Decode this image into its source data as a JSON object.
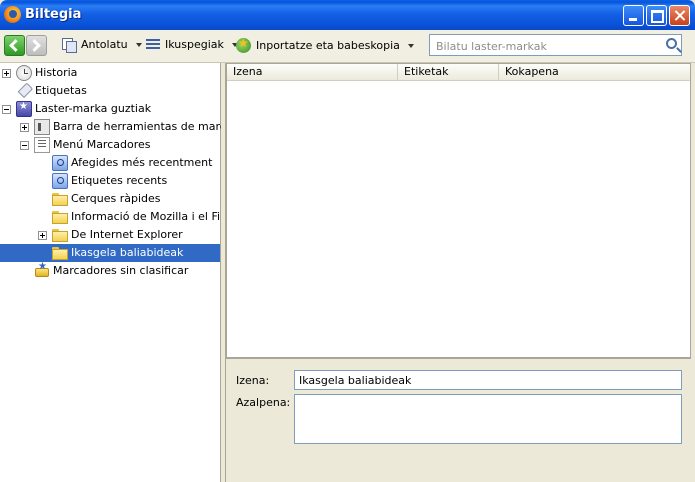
{
  "window": {
    "title": "Biltegia"
  },
  "toolbar": {
    "organize_label": "Antolatu",
    "views_label": "Ikuspegiak",
    "import_label": "Inportatze eta babeskopia",
    "search_placeholder": "Bilatu laster-markak"
  },
  "tree": {
    "items": [
      {
        "label": "Historia",
        "icon": "history-clock-icon",
        "twisty": "plus"
      },
      {
        "label": "Etiquetas",
        "icon": "tag-icon",
        "twisty": "none"
      },
      {
        "label": "Laster-marka guztiak",
        "icon": "all-bookmarks-icon",
        "twisty": "minus"
      },
      {
        "label": "Barra de herramientas de marca...",
        "icon": "bookmarks-toolbar-icon",
        "twisty": "plus"
      },
      {
        "label": "Menú Marcadores",
        "icon": "bookmarks-menu-icon",
        "twisty": "minus"
      },
      {
        "label": "Afegides més recentment",
        "icon": "smart-query-icon",
        "twisty": "none"
      },
      {
        "label": "Etiquetes recents",
        "icon": "smart-query-icon",
        "twisty": "none"
      },
      {
        "label": "Cerques ràpides",
        "icon": "folder-icon",
        "twisty": "none"
      },
      {
        "label": "Informació de Mozilla i el Fire...",
        "icon": "folder-icon",
        "twisty": "none"
      },
      {
        "label": "De Internet Explorer",
        "icon": "folder-icon",
        "twisty": "plus"
      },
      {
        "label": "Ikasgela baliabideak",
        "icon": "folder-icon",
        "twisty": "none",
        "selected": true
      },
      {
        "label": "Marcadores sin clasificar",
        "icon": "unsorted-bookmarks-icon",
        "twisty": "none"
      }
    ]
  },
  "list": {
    "columns": [
      "Izena",
      "Etiketak",
      "Kokapena"
    ]
  },
  "details": {
    "name_label": "Izena:",
    "name_value": "Ikasgela baliabideak",
    "description_label": "Azalpena:",
    "description_value": ""
  }
}
